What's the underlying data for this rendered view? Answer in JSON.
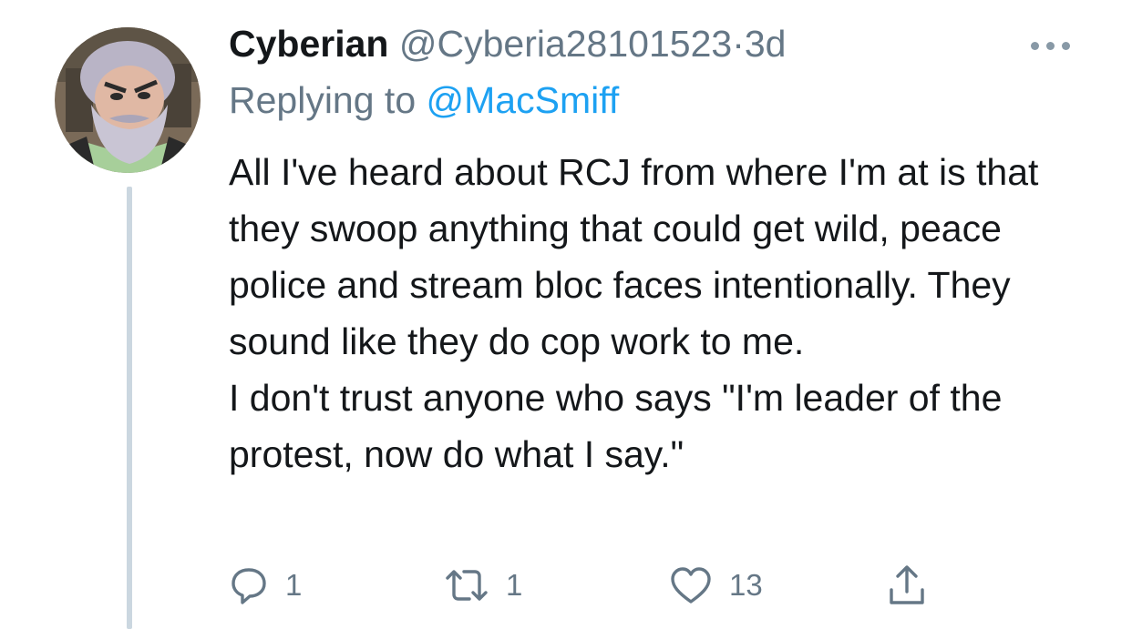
{
  "tweet": {
    "author_name": "Cyberian",
    "author_handle": "@Cyberia28101523",
    "separator": "·",
    "time": "3d",
    "reply_prefix": "Replying to",
    "reply_to": "@MacSmiff",
    "paragraphs": [
      "All I've heard about RCJ from where I'm at is that they swoop anything that could get wild, peace police and stream bloc faces intentionally. They sound like they do cop work to me.",
      "I don't trust anyone who says \"I'm leader of the protest, now do what I say.\""
    ]
  },
  "actions": {
    "reply": {
      "icon": "reply-icon",
      "count": "1"
    },
    "retweet": {
      "icon": "retweet-icon",
      "count": "1"
    },
    "like": {
      "icon": "heart-icon",
      "count": "13"
    },
    "share": {
      "icon": "share-icon"
    }
  },
  "colors": {
    "text": "#14171a",
    "secondary": "#657786",
    "link": "#1da1f2",
    "thread_line": "#cbd7e0"
  }
}
